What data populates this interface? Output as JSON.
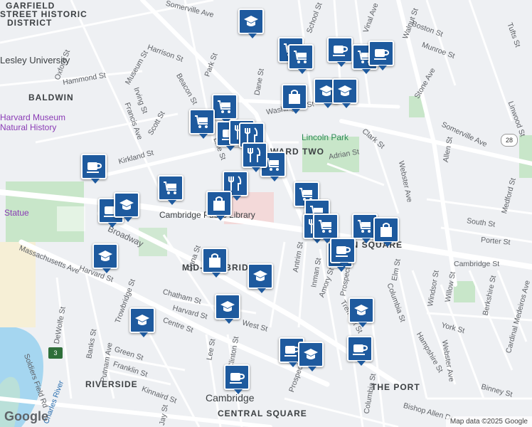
{
  "map": {
    "streets": [
      "Somerville Ave",
      "School St",
      "Vinal Ave",
      "Walnut St",
      "Boston St",
      "Munroe St",
      "Tufts St",
      "Harrison St",
      "Park St",
      "Dane St",
      "Hammond St",
      "Museum St",
      "Oxford St",
      "Beacon St",
      "Washington St",
      "Stone Ave",
      "Irving St",
      "Francis Ave",
      "Scott St",
      "Kirkland St",
      "Line St",
      "Clark St",
      "Adrian St",
      "Somerville Ave",
      "Linwood St",
      "Allen St",
      "Medford St",
      "Webster Ave",
      "Cambridge St",
      "South St",
      "Porter St",
      "Broadway",
      "Massachusetts Ave",
      "Dana St",
      "Harvard St",
      "Antrim St",
      "Inman St",
      "Amory St",
      "Prospect St",
      "Elm St",
      "Windsor St",
      "Willow St",
      "Berkshire St",
      "Cardinal Medeiros Ave",
      "Trowbridge St",
      "Chatham St",
      "Harvard St",
      "West St",
      "Tremont St",
      "Columbia St",
      "Hampshire St",
      "York St",
      "Webster Ave",
      "Centre St",
      "Banks St",
      "DeWolfe St",
      "Green St",
      "Franklin St",
      "Putnam Ave",
      "Lee St",
      "Clinton St",
      "Kinnaird St",
      "Jay St",
      "Binney St",
      "Bishop Allen Dr",
      "Columbia St",
      "Prospect St",
      "Soldiers Field Rd",
      "Charles River"
    ],
    "neighborhoods": [
      "GARFIELD",
      "STREET HISTORIC",
      "DISTRICT",
      "BALDWIN",
      "WARD TWO",
      "MID-CAMBRIDGE",
      "INMAN SQUARE",
      "RIVERSIDE",
      "THE PORT",
      "CENTRAL SQUARE"
    ],
    "places": [
      "Lesley University",
      "Harvard Museum",
      "Natural History",
      "Cambridge Public Library",
      "Lincoln Park",
      "Statue",
      "Cambridge"
    ],
    "route_shield": "28",
    "highway_shield": "3",
    "google_label": "Google",
    "attribution": "Map data ©2025 Google",
    "colors": {
      "pin": "#1e5a9e",
      "water": "#a5d6f0",
      "park": "#c8e6c9",
      "road": "#ffffff",
      "land": "#eef0f3"
    },
    "markers": [
      {
        "icon": "school-icon"
      },
      {
        "icon": "shopping-cart-icon"
      },
      {
        "icon": "shopping-cart-icon"
      },
      {
        "icon": "coffee-icon"
      },
      {
        "icon": "shopping-cart-icon"
      },
      {
        "icon": "coffee-icon"
      },
      {
        "icon": "shopping-bag-icon"
      },
      {
        "icon": "school-icon"
      },
      {
        "icon": "school-icon"
      },
      {
        "icon": "shopping-cart-icon"
      },
      {
        "icon": "shopping-cart-icon"
      },
      {
        "icon": "coffee-icon"
      },
      {
        "icon": "restaurant-icon"
      },
      {
        "icon": "restaurant-icon"
      },
      {
        "icon": "shopping-cart-icon"
      },
      {
        "icon": "coffee-icon"
      },
      {
        "icon": "shopping-cart-icon"
      },
      {
        "icon": "restaurant-icon"
      },
      {
        "icon": "coffee-icon"
      },
      {
        "icon": "school-icon"
      },
      {
        "icon": "shopping-bag-icon"
      },
      {
        "icon": "restaurant-icon"
      },
      {
        "icon": "shopping-cart-icon"
      },
      {
        "icon": "shopping-cart-icon"
      },
      {
        "icon": "restaurant-icon"
      },
      {
        "icon": "shopping-cart-icon"
      },
      {
        "icon": "shopping-cart-icon"
      },
      {
        "icon": "shopping-bag-icon"
      },
      {
        "icon": "coffee-icon"
      },
      {
        "icon": "school-icon"
      },
      {
        "icon": "shopping-bag-icon"
      },
      {
        "icon": "school-icon"
      },
      {
        "icon": "school-icon"
      },
      {
        "icon": "school-icon"
      },
      {
        "icon": "school-icon"
      },
      {
        "icon": "coffee-icon"
      },
      {
        "icon": "coffee-icon"
      },
      {
        "icon": "coffee-icon"
      },
      {
        "icon": "school-icon"
      },
      {
        "icon": "coffee-icon"
      }
    ]
  }
}
